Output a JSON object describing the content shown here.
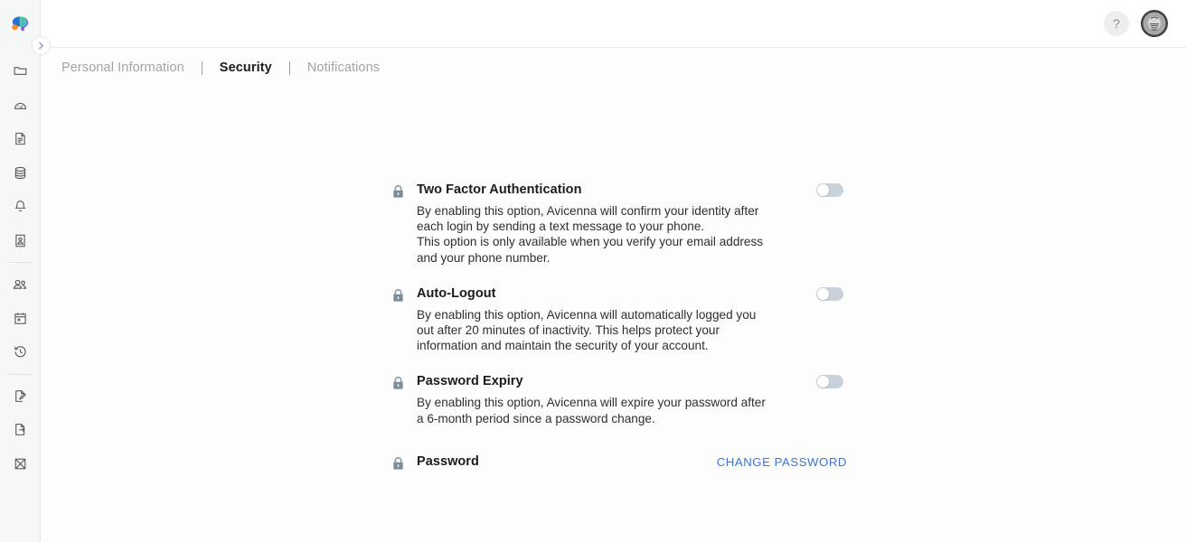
{
  "app": {
    "logo_name": "avicenna-brain-logo",
    "brand_colors": {
      "orange": "#f28f2b",
      "blue": "#2d6fd1",
      "teal": "#48c2b0",
      "purple": "#8a5fd4"
    },
    "accent_link": "#3d74d4",
    "toggle_off_track": "#c9d1da",
    "sidebar_bg": "#f6f7f7"
  },
  "sidebar": {
    "expand_handle": {
      "icon": "chevron-right-icon",
      "label": "Expand sidebar"
    },
    "groups": [
      {
        "items": [
          {
            "icon": "folder-icon",
            "label": "Projects"
          },
          {
            "icon": "dashboard-gauge-icon",
            "label": "Dashboard"
          },
          {
            "icon": "document-icon",
            "label": "Documents"
          },
          {
            "icon": "database-icon",
            "label": "Data"
          },
          {
            "icon": "bell-icon",
            "label": "Notifications"
          },
          {
            "icon": "id-card-icon",
            "label": "Profile Card"
          }
        ]
      },
      {
        "items": [
          {
            "icon": "users-icon",
            "label": "Users"
          },
          {
            "icon": "calendar-icon",
            "label": "Calendar"
          },
          {
            "icon": "history-clock-icon",
            "label": "History"
          }
        ]
      },
      {
        "items": [
          {
            "icon": "document-edit-icon",
            "label": "Edit Form"
          },
          {
            "icon": "document-export-icon",
            "label": "Export"
          },
          {
            "icon": "chart-crossed-icon",
            "label": "Analysis"
          }
        ]
      }
    ]
  },
  "topbar": {
    "help_label": "?",
    "avatar_name": "user-avatar"
  },
  "tabs": [
    {
      "label": "Personal Information",
      "active": false
    },
    {
      "label": "Security",
      "active": true
    },
    {
      "label": "Notifications",
      "active": false
    }
  ],
  "security": {
    "settings": [
      {
        "id": "two-factor-authentication",
        "title": "Two Factor Authentication",
        "description": "By enabling this option, Avicenna will confirm your identity after each login by sending a text message to your phone.\nThis option is only available when you verify your email address and your phone number.",
        "control": "toggle",
        "toggle_on": false
      },
      {
        "id": "auto-logout",
        "title": "Auto-Logout",
        "description": "By enabling this option, Avicenna will automatically logged you out after 20 minutes of inactivity. This helps protect your information and maintain the security of your account.",
        "control": "toggle",
        "toggle_on": false
      },
      {
        "id": "password-expiry",
        "title": "Password Expiry",
        "description": "By enabling this option, Avicenna will expire your password after a 6-month period since a password change.",
        "control": "toggle",
        "toggle_on": false
      },
      {
        "id": "password",
        "title": "Password",
        "description": "",
        "control": "link",
        "link_label": "CHANGE PASSWORD"
      }
    ]
  }
}
